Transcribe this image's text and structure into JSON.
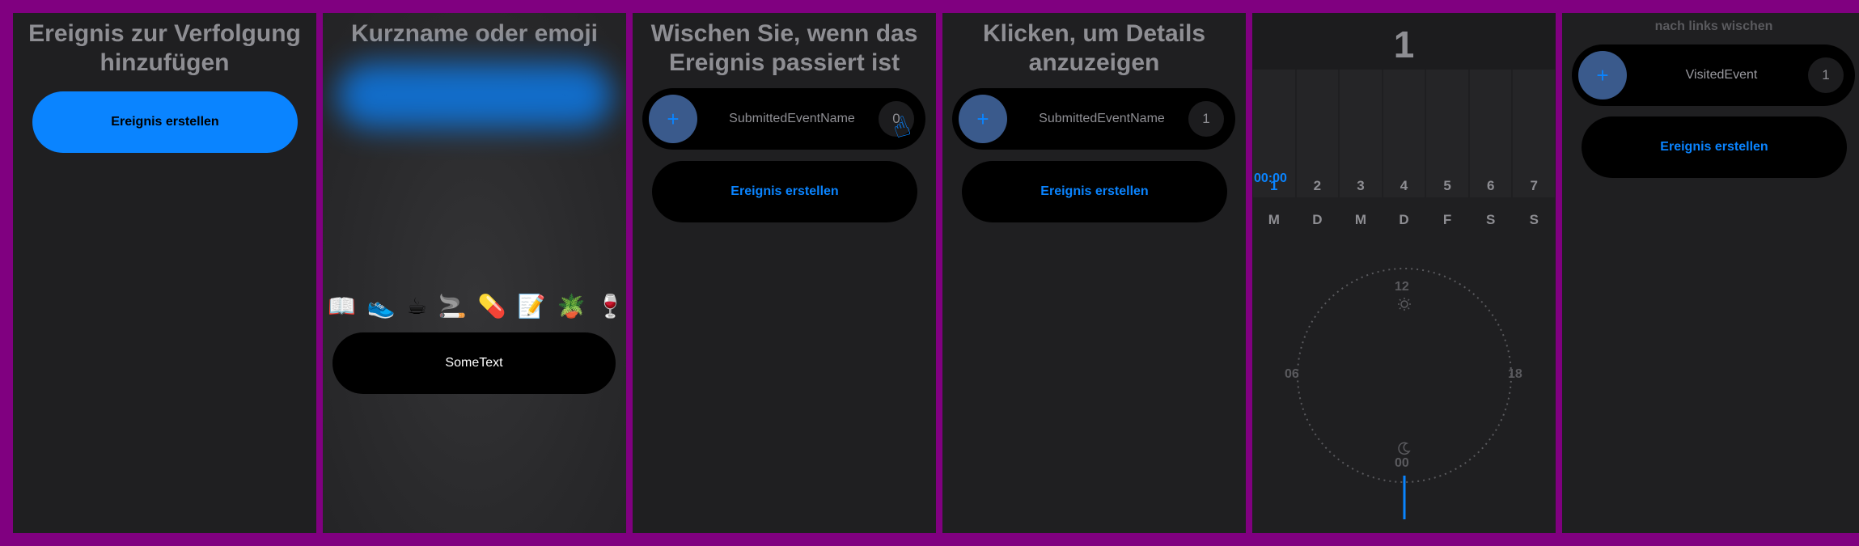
{
  "panels": {
    "p1": {
      "title": "Ereignis zur Verfolgung hinzufügen",
      "button": "Ereignis erstellen"
    },
    "p2": {
      "title": "Kurzname oder emoji",
      "emojis": [
        "📖",
        "👟",
        "☕",
        "🚬",
        "💊",
        "📝",
        "🪴",
        "🍷",
        "🍩"
      ],
      "text": "SomeText"
    },
    "p3": {
      "title": "Wischen Sie, wenn das Ereignis passiert ist",
      "event_name": "SubmittedEventName",
      "count": "0",
      "button": "Ereignis erstellen"
    },
    "p4": {
      "title": "Klicken, um Details anzuzeigen",
      "event_name": "SubmittedEventName",
      "count": "1",
      "button": "Ereignis erstellen"
    },
    "p5": {
      "total": "1",
      "time": "00:00",
      "days_numbers": [
        "1",
        "2",
        "3",
        "4",
        "5",
        "6",
        "7"
      ],
      "days_letters": [
        "M",
        "D",
        "M",
        "D",
        "F",
        "S",
        "S"
      ],
      "clock_labels": {
        "top": "12",
        "left": "06",
        "right": "18",
        "bottom": "00"
      }
    },
    "p6": {
      "hint": "nach links wischen",
      "event_name": "VisitedEvent",
      "count": "1",
      "button": "Ereignis erstellen"
    }
  },
  "icons": {
    "plus": "plus-icon",
    "sun": "sun-icon",
    "moon": "moon-icon",
    "hand": "pointer-hand-icon"
  },
  "colors": {
    "accent": "#0a84ff",
    "panel_bg": "#1f1f21",
    "frame": "#800080"
  }
}
